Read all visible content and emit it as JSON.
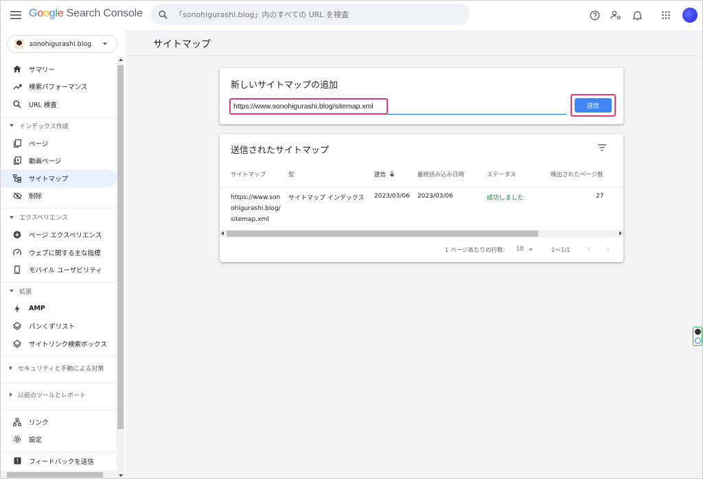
{
  "app": {
    "logo_google": "Google",
    "logo_product": "Search Console",
    "search_placeholder": "「sonohigurashi.blog」内のすべての URL を検査"
  },
  "property": {
    "name": "sonohigurashi.blog"
  },
  "sidebar": {
    "top_items": [
      {
        "label": "サマリー",
        "icon": "home-icon"
      },
      {
        "label": "検索パフォーマンス",
        "icon": "trending-up-icon"
      },
      {
        "label": "URL 検査",
        "icon": "search-icon"
      }
    ],
    "index_section": "インデックス作成",
    "index_items": [
      {
        "label": "ページ",
        "icon": "pages-icon"
      },
      {
        "label": "動画ページ",
        "icon": "video-page-icon"
      },
      {
        "label": "サイトマップ",
        "icon": "sitemap-icon",
        "active": true
      },
      {
        "label": "削除",
        "icon": "visibility-off-icon"
      }
    ],
    "experience_section": "エクスペリエンス",
    "experience_items": [
      {
        "label": "ページ エクスペリエンス",
        "icon": "plus-circle-icon"
      },
      {
        "label": "ウェブに関する主な指標",
        "icon": "speed-icon"
      },
      {
        "label": "モバイル ユーザビリティ",
        "icon": "phone-icon"
      }
    ],
    "enhancements_section": "拡張",
    "enhancement_items": [
      {
        "label": "AMP",
        "icon": "bolt-icon"
      },
      {
        "label": "パンくずリスト",
        "icon": "layers-icon"
      },
      {
        "label": "サイトリンク検索ボックス",
        "icon": "layers-icon"
      }
    ],
    "security_section": "セキュリティと手動による対策",
    "legacy_section": "以前のツールとレポート",
    "bottom_items": [
      {
        "label": "リンク",
        "icon": "links-icon"
      },
      {
        "label": "設定",
        "icon": "settings-icon"
      }
    ],
    "feedback": "フィードバックを送信"
  },
  "page": {
    "title": "サイトマップ"
  },
  "add_sitemap": {
    "title": "新しいサイトマップの追加",
    "url_value": "https://www.sonohigurashi.blog/sitemap.xml",
    "submit_label": "送信"
  },
  "submitted": {
    "title": "送信されたサイトマップ",
    "columns": [
      "サイトマップ",
      "型",
      "送信",
      "最終読み込み日時",
      "ステータス",
      "検出されたページ数"
    ],
    "rows": [
      {
        "url_lines": [
          "https://www.son",
          "ohigurashi.blog/",
          "sitemap.xml"
        ],
        "type": "サイトマップ インデックス",
        "submitted": "2023/03/06",
        "last_read": "2023/03/06",
        "status": "成功しました",
        "pages": "27"
      }
    ],
    "pager": {
      "rows_per_page_label": "1 ページあたりの行数:",
      "rows_per_page": "10",
      "range": "1〜1/1"
    }
  }
}
